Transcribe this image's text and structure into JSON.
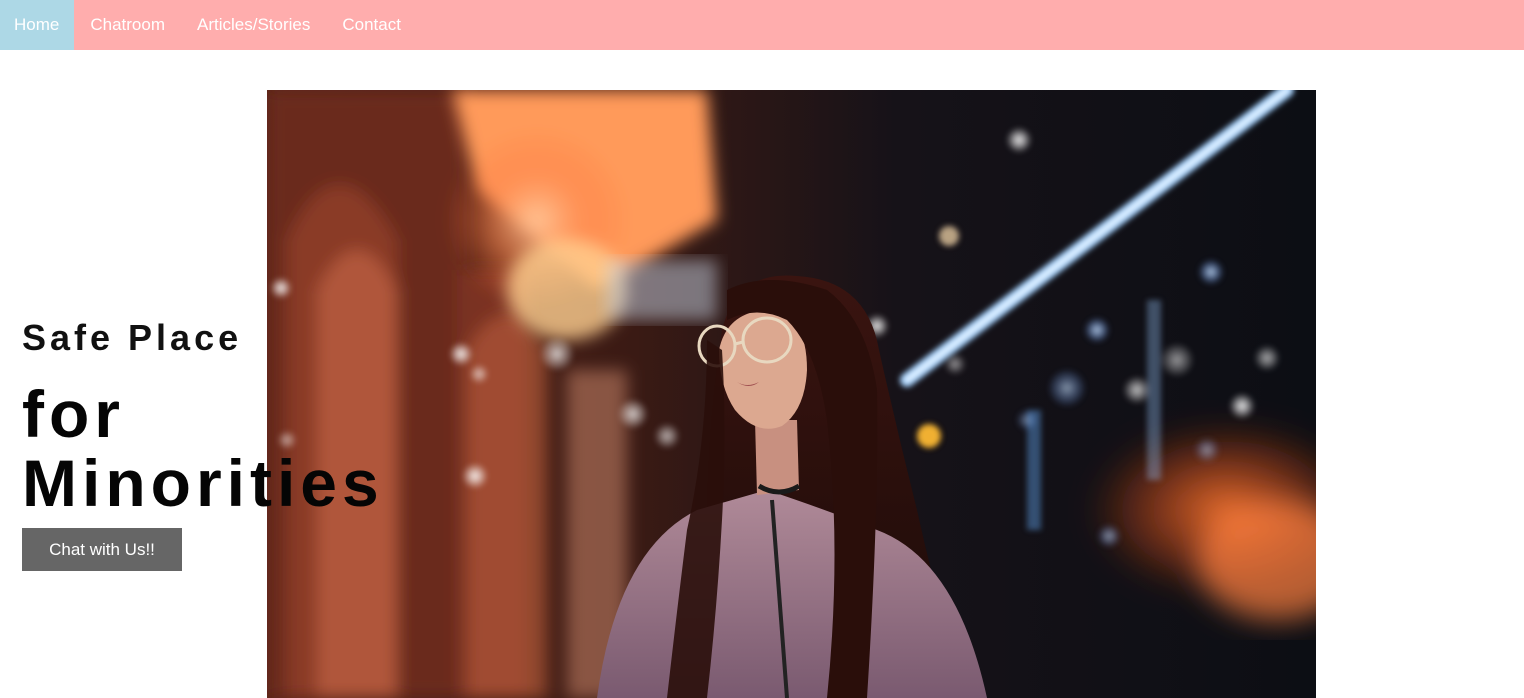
{
  "nav": {
    "items": [
      {
        "label": "Home",
        "active": true
      },
      {
        "label": "Chatroom",
        "active": false
      },
      {
        "label": "Articles/Stories",
        "active": false
      },
      {
        "label": "Contact",
        "active": false
      }
    ],
    "bg_color": "#ffadad",
    "active_color": "#add8e6"
  },
  "hero": {
    "subtitle": "Safe Place",
    "title_line1": "for",
    "title_line2": "Minorities",
    "cta_label": "Chat with Us!!",
    "image_icon": "photo-woman-neon-street"
  }
}
